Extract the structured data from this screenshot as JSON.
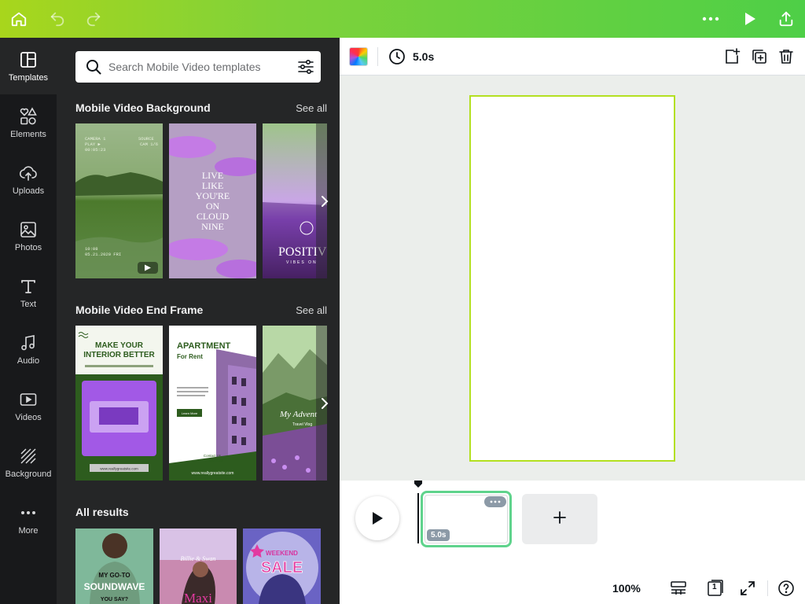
{
  "topbar": {
    "home_icon": "home-icon",
    "undo_icon": "undo-icon",
    "redo_icon": "redo-icon",
    "more_icon": "more-horizontal-icon",
    "present_icon": "play-icon",
    "share_icon": "share-upload-icon"
  },
  "rail": {
    "items": [
      {
        "label": "Templates",
        "icon": "templates-icon"
      },
      {
        "label": "Elements",
        "icon": "elements-icon"
      },
      {
        "label": "Uploads",
        "icon": "cloud-upload-icon"
      },
      {
        "label": "Photos",
        "icon": "image-icon"
      },
      {
        "label": "Text",
        "icon": "text-icon"
      },
      {
        "label": "Audio",
        "icon": "music-note-icon"
      },
      {
        "label": "Videos",
        "icon": "video-icon"
      },
      {
        "label": "Background",
        "icon": "background-pattern-icon"
      },
      {
        "label": "More",
        "icon": "more-horizontal-icon"
      }
    ]
  },
  "panel": {
    "search": {
      "placeholder": "Search Mobile Video templates",
      "value": ""
    },
    "sections": [
      {
        "title": "Mobile Video Background",
        "see_all": "See all",
        "thumbs": [
          {
            "lines": [
              "CAMERA 1",
              "PLAY ▶",
              "00:05:23",
              "SOURCE",
              "CAM 1/6",
              "10:08",
              "05.21.2020 FRI"
            ]
          },
          {
            "lines": [
              "LIVE",
              "LIKE",
              "YOU'RE",
              "ON",
              "CLOUD",
              "NINE"
            ]
          },
          {
            "lines": [
              "POSITIV",
              "VIBES ON"
            ]
          }
        ]
      },
      {
        "title": "Mobile Video End Frame",
        "see_all": "See all",
        "thumbs": [
          {
            "lines": [
              "MAKE YOUR",
              "INTERIOR BETTER",
              "www.reallygreatsite.com"
            ]
          },
          {
            "lines": [
              "APARTMENT",
              "For Rent",
              "Learn More",
              "Contact Us",
              "123-456-7890",
              "www.reallygreatsite.com"
            ]
          },
          {
            "lines": [
              "My Advent",
              "Travel Vlog"
            ]
          }
        ]
      },
      {
        "title": "All results",
        "thumbs": [
          {
            "lines": [
              "MY GO-TO",
              "SOUNDWAVE",
              "YOU SAY?"
            ]
          },
          {
            "lines": [
              "Billie & Swan",
              "Maxi"
            ]
          },
          {
            "lines": [
              "WEEKEND",
              "SALE"
            ]
          }
        ]
      }
    ]
  },
  "editor": {
    "duration": "5.0s",
    "icons": [
      "color-picker-icon",
      "clock-icon",
      "add-page-icon",
      "duplicate-page-icon",
      "trash-icon"
    ]
  },
  "timeline": {
    "clip_duration": "5.0s",
    "zoom": "100%",
    "page_count": "1",
    "icons": [
      "play-icon",
      "more-horizontal-icon",
      "plus-icon",
      "grid-view-icon",
      "pages-icon",
      "fullscreen-icon",
      "help-icon"
    ]
  },
  "colors": {
    "topbar_gradient_start": "#a8d61c",
    "topbar_gradient_end": "#4ecf47",
    "rail_bg": "#18191b",
    "panel_bg": "#252627",
    "page_border": "#b3e020",
    "clip_border": "#5fd38c",
    "thumb_purple": "#b06cf0",
    "thumb_green": "#2d5c1e"
  }
}
